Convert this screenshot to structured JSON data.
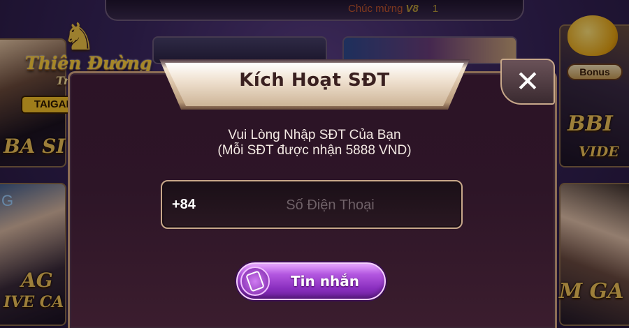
{
  "background": {
    "marquee": {
      "text": "Chúc mừng",
      "brand": "V8",
      "amount": "1"
    },
    "logo": {
      "title": "Thiên Đường",
      "subtitle": "Trò Chơi",
      "site": "TAIGAMETDTC.NET",
      "emblem": "horse-emblem"
    },
    "bonus": {
      "label": "Bonus",
      "icon": "piggy-bank-icon"
    },
    "game_cards": {
      "left_top": "BA SI",
      "left_mid_partial": "G",
      "left_bottom_1": "AG",
      "left_bottom_2": "IVE CA",
      "right_top_1": "BBI",
      "right_top_2": "VIDE",
      "right_bottom": "M GA"
    }
  },
  "dialog": {
    "title": "Kích Hoạt SĐT",
    "close_icon": "close-icon",
    "instruction_line1": "Vui Lòng Nhập SĐT Của Bạn",
    "instruction_line2": "(Mỗi SĐT được nhận 5888 VND)",
    "phone": {
      "country_code": "+84",
      "value": "",
      "placeholder": "Số Điện Thoại"
    },
    "submit": {
      "label": "Tin nhắn",
      "icon": "phone-message-icon"
    }
  },
  "colors": {
    "accent_gold": "#f0c348",
    "dialog_bg": "#2c1326",
    "button_purple": "#8a2fbf",
    "border_tan": "#c8a88a"
  }
}
